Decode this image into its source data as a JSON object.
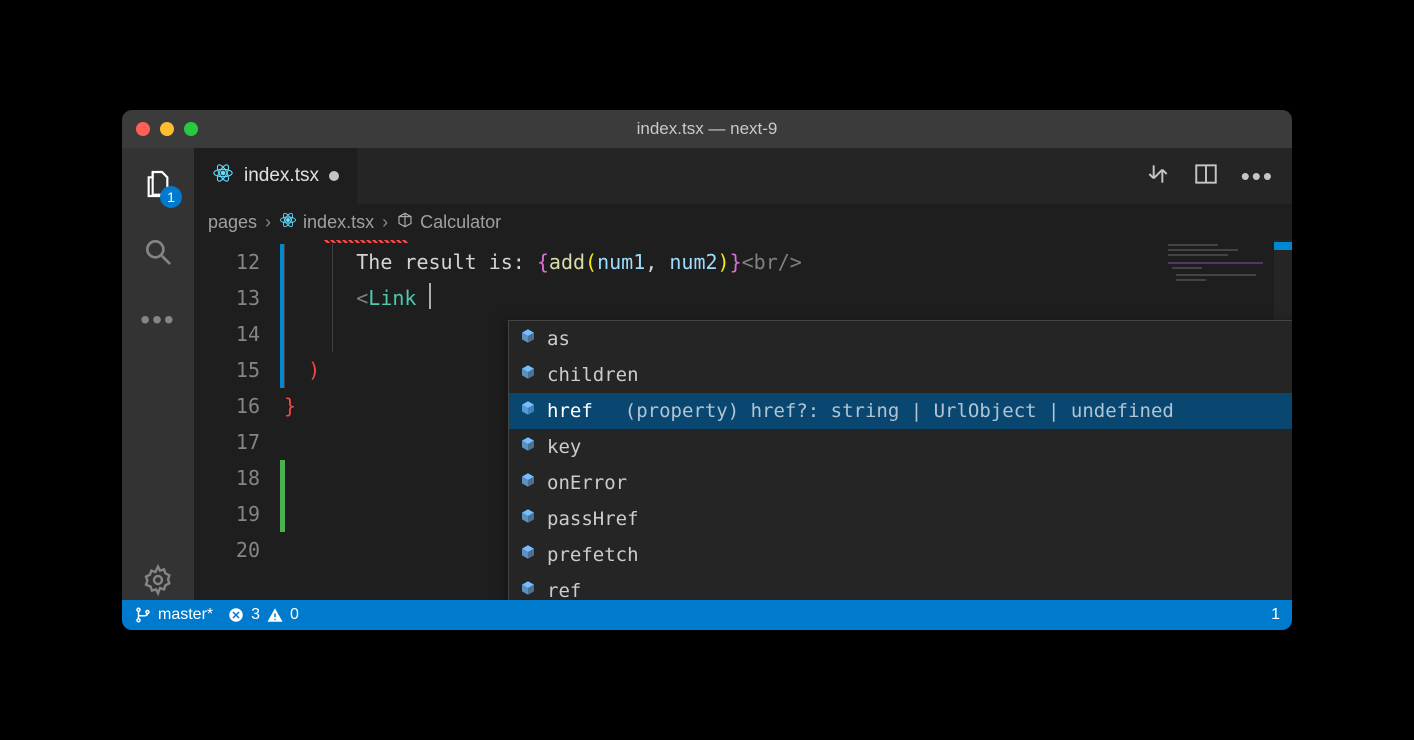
{
  "window": {
    "title": "index.tsx — next-9"
  },
  "activityBar": {
    "explorerBadge": "1"
  },
  "tabs": {
    "active": {
      "label": "index.tsx",
      "dirty": true
    }
  },
  "breadcrumb": {
    "folder": "pages",
    "file": "index.tsx",
    "symbol": "Calculator"
  },
  "editor": {
    "lineNumbers": [
      "12",
      "13",
      "14",
      "15",
      "16",
      "17",
      "18",
      "19",
      "20"
    ],
    "line12": {
      "prefix": "      The result is: ",
      "fn": "add",
      "arg1": "num1",
      "arg2": "num2",
      "tag": "br"
    },
    "line13": {
      "component": "Link"
    },
    "line15": {
      "paren": ")"
    },
    "line16": {
      "brace": "}"
    }
  },
  "autocomplete": {
    "items": [
      {
        "label": "as",
        "selected": false
      },
      {
        "label": "children",
        "selected": false
      },
      {
        "label": "href",
        "selected": true,
        "detail": "(property) href?: string | UrlObject | undefined"
      },
      {
        "label": "key",
        "selected": false
      },
      {
        "label": "onError",
        "selected": false
      },
      {
        "label": "passHref",
        "selected": false
      },
      {
        "label": "prefetch",
        "selected": false
      },
      {
        "label": "ref",
        "selected": false
      }
    ]
  },
  "statusBar": {
    "branch": "master*",
    "errors": "3",
    "warnings": "0",
    "rightValue": "1"
  }
}
